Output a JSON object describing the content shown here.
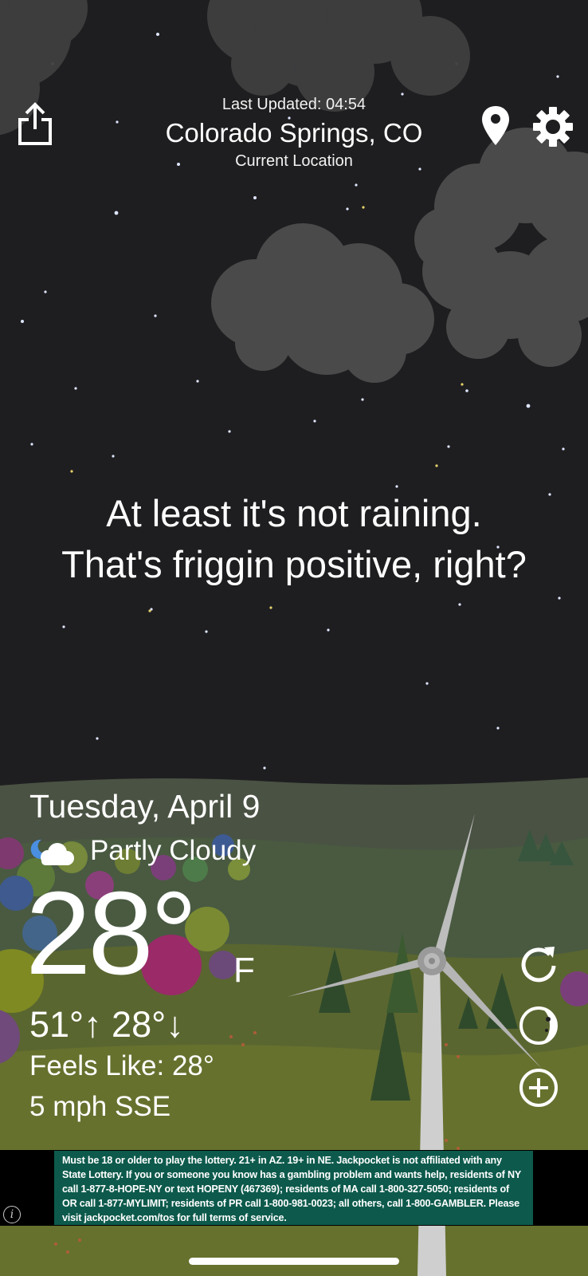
{
  "header": {
    "last_updated": "Last Updated: 04:54",
    "city": "Colorado Springs, CO",
    "location_label": "Current Location",
    "icons": [
      "share-icon",
      "location-pin-icon",
      "gear-icon"
    ]
  },
  "quote": {
    "line1": "At least it's not raining.",
    "line2": "That's friggin positive, right?"
  },
  "weather": {
    "date": "Tuesday, April 9",
    "condition": "Partly Cloudy",
    "condition_icon": "partly-cloudy-night-icon",
    "temperature": "28°",
    "unit": "F",
    "high_low": "51°↑ 28°↓",
    "feels_like": "Feels Like: 28°",
    "wind": "5 mph SSE"
  },
  "side_buttons": [
    "refresh-icon",
    "moon-phase-icon",
    "add-location-icon"
  ],
  "ad": {
    "text": "Must be 18 or older to play the lottery. 21+ in AZ. 19+ in NE. Jackpocket is not affiliated with any State Lottery. If you or someone you know has a gambling problem and wants help, residents of NY call 1-877-8-HOPE-NY or text HOPENY (467369); residents of MA call 1-800-327-5050; residents of OR call 1-877-MYLIMIT; residents of PR call 1-800-981-0023; all others, call 1-800-GAMBLER. Please visit jackpocket.com/tos for full terms of service.",
    "info_glyph": "i"
  },
  "colors": {
    "sky": "#1e1e20",
    "hills": "#4d5a41",
    "grass": "#5f6c2c",
    "ad_background": "#0d5a4c"
  }
}
